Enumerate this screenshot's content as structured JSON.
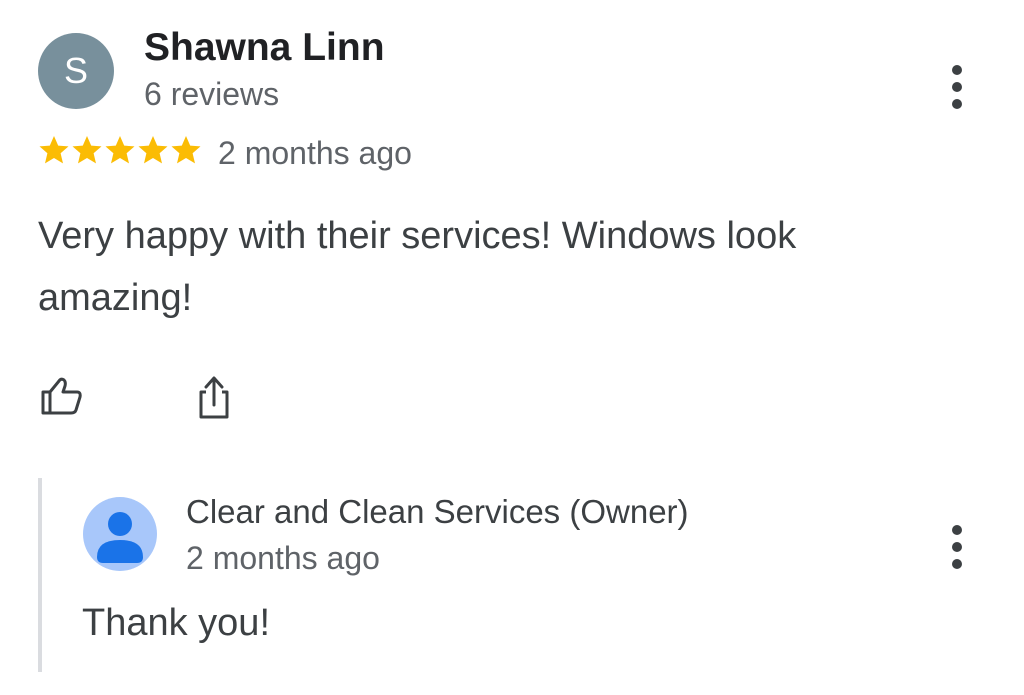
{
  "review": {
    "avatar_letter": "S",
    "reviewer_name": "Shawna Linn",
    "review_count": "6 reviews",
    "rating": 5,
    "rating_max": 5,
    "time": "2 months ago",
    "text": "Very happy with their services! Windows look amazing!"
  },
  "owner_response": {
    "name": "Clear and Clean Services (Owner)",
    "time": "2 months ago",
    "text": "Thank you!"
  },
  "icons": {
    "more_review": "more-vert-icon",
    "like": "thumb-up-icon",
    "share": "share-icon",
    "star": "star-icon",
    "owner_avatar": "person-icon",
    "more_reply": "more-vert-icon"
  },
  "colors": {
    "star": "#fbbc04",
    "reviewer_avatar_bg": "#78909c",
    "owner_avatar_bg": "#a8c7fa",
    "owner_avatar_fg": "#1a73e8",
    "secondary_text": "#5f6368",
    "primary_text": "#202124",
    "reply_bar": "#dadce0"
  }
}
